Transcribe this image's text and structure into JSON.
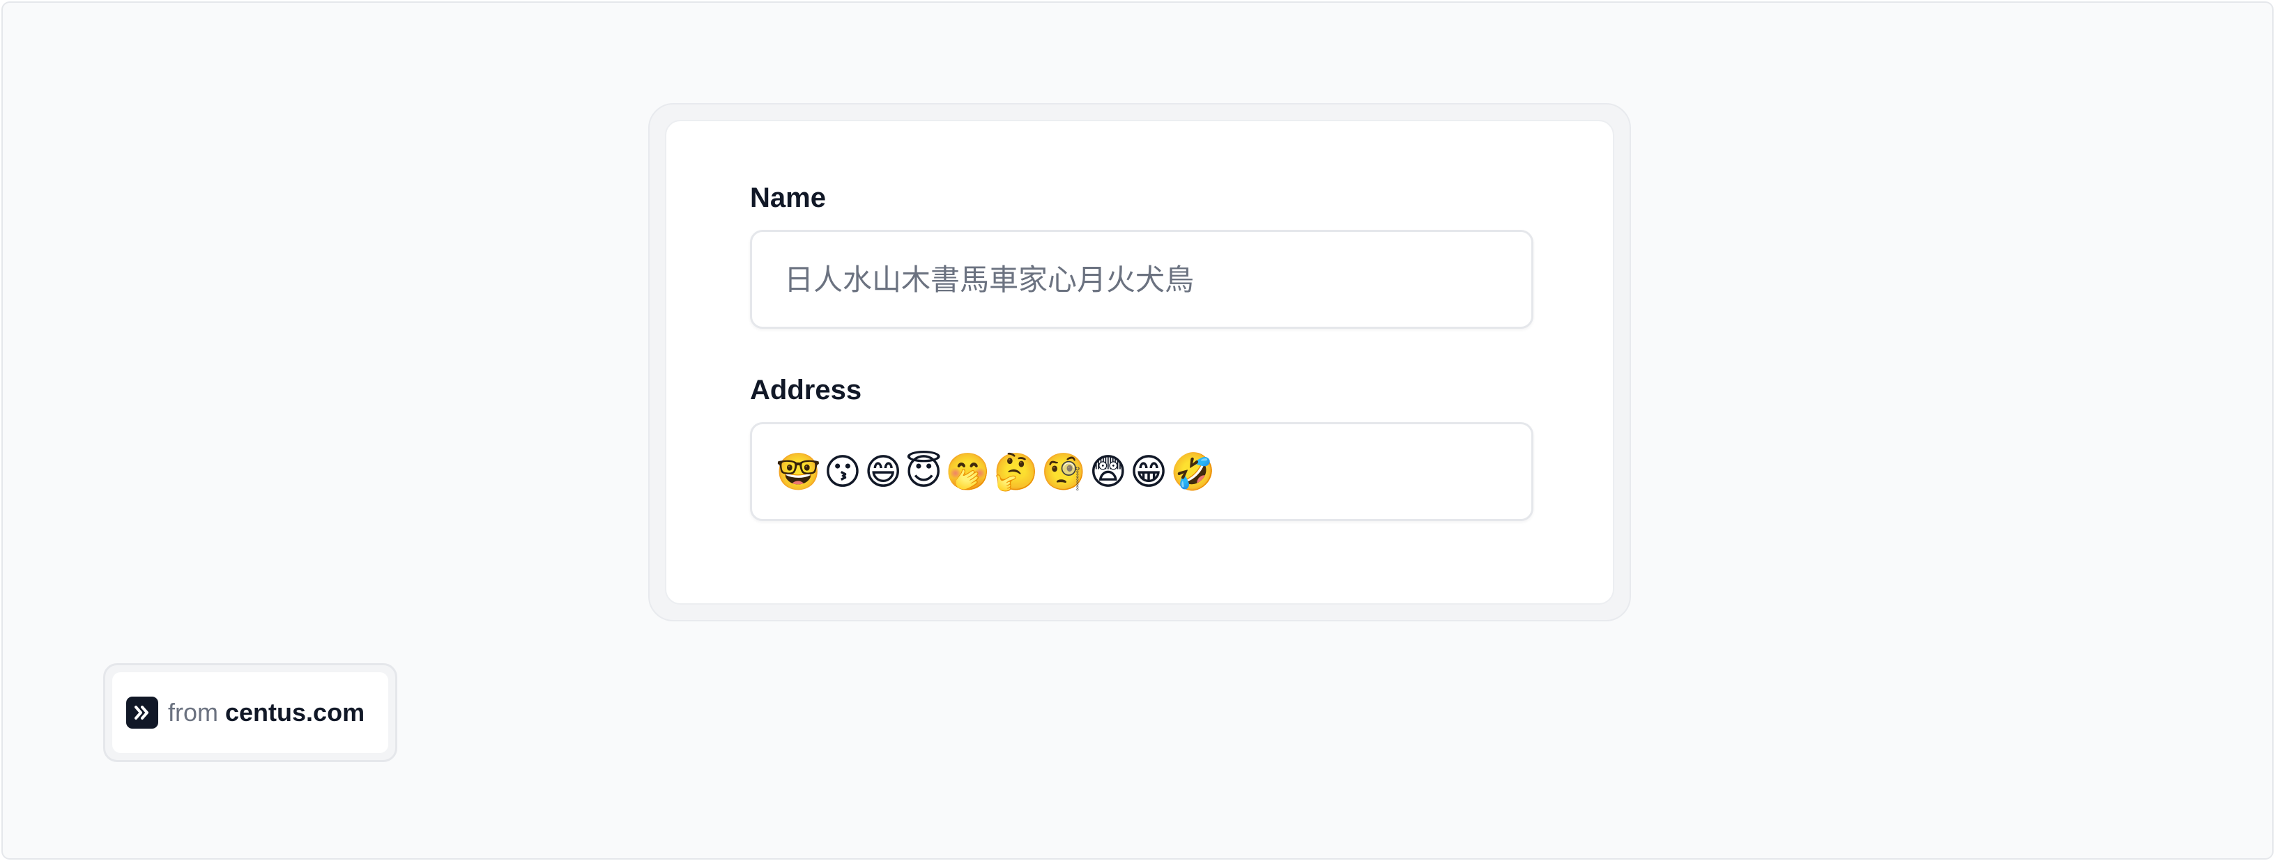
{
  "form": {
    "name_label": "Name",
    "name_placeholder": "日人水山木書馬車家心月火犬鳥",
    "address_label": "Address",
    "address_value": "🤓😗😄😇🤭🤔🧐😨😁🤣"
  },
  "badge": {
    "from_text": "from",
    "domain_text": "centus.com",
    "logo_icon": "double-chevron-right-icon"
  },
  "colors": {
    "background": "#f9fafb",
    "label_text": "#111827",
    "placeholder_text": "#6b7280",
    "logo_bg": "#111827"
  }
}
